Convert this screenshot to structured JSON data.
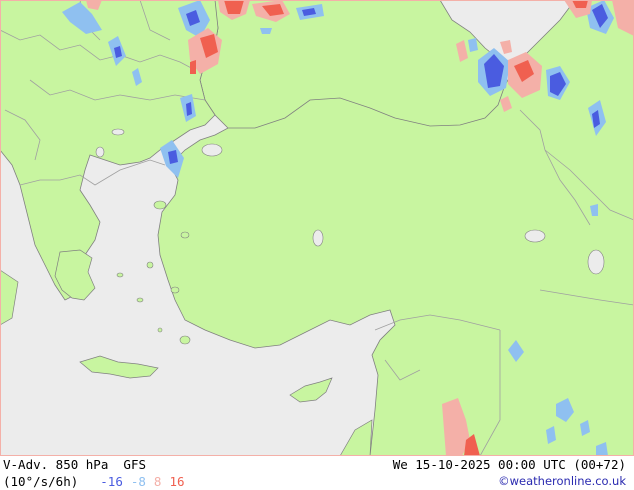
{
  "title": {
    "field": "V-Adv. 850 hPa",
    "model": "GFS",
    "units": "(10°/s/6h)"
  },
  "valid_time": "We 15-10-2025 00:00 UTC (00+72)",
  "credit": "©weatheronline.co.uk",
  "legend": {
    "values": [
      {
        "label": "-16",
        "color": "#4a5ce0"
      },
      {
        "label": "-8",
        "color": "#8fc0f0"
      },
      {
        "label": "8",
        "color": "#f4b0a8"
      },
      {
        "label": "16",
        "color": "#f06050"
      }
    ]
  },
  "colors": {
    "land": "#c8f5a0",
    "sea": "#ececec",
    "border": "#a0a0a0",
    "coast": "#808080"
  }
}
